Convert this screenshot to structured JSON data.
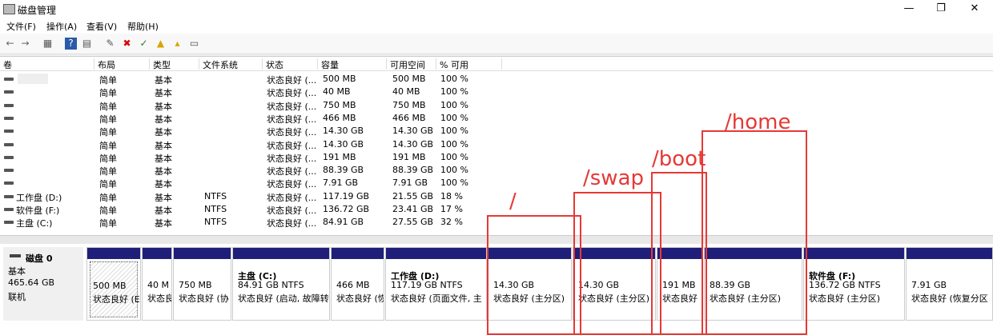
{
  "window": {
    "title": "磁盘管理",
    "minimize": "—",
    "maximize": "❐",
    "close": "✕"
  },
  "menu": [
    "文件(F)",
    "操作(A)",
    "查看(V)",
    "帮助(H)"
  ],
  "toolbar": [
    "←",
    "→",
    "▦",
    "?",
    "▤",
    "✎",
    "✖",
    "✓",
    "▲",
    "▴",
    "▭"
  ],
  "columns": [
    "卷",
    "布局",
    "类型",
    "文件系统",
    "状态",
    "容量",
    "可用空间",
    "% 可用"
  ],
  "volumes": [
    {
      "name": "",
      "layout": "简单",
      "type": "基本",
      "fs": "",
      "status": "状态良好 (...",
      "capacity": "500 MB",
      "free": "500 MB",
      "pct": "100 %"
    },
    {
      "name": "",
      "layout": "简单",
      "type": "基本",
      "fs": "",
      "status": "状态良好 (...",
      "capacity": "40 MB",
      "free": "40 MB",
      "pct": "100 %"
    },
    {
      "name": "",
      "layout": "简单",
      "type": "基本",
      "fs": "",
      "status": "状态良好 (...",
      "capacity": "750 MB",
      "free": "750 MB",
      "pct": "100 %"
    },
    {
      "name": "",
      "layout": "简单",
      "type": "基本",
      "fs": "",
      "status": "状态良好 (...",
      "capacity": "466 MB",
      "free": "466 MB",
      "pct": "100 %"
    },
    {
      "name": "",
      "layout": "简单",
      "type": "基本",
      "fs": "",
      "status": "状态良好 (...",
      "capacity": "14.30 GB",
      "free": "14.30 GB",
      "pct": "100 %"
    },
    {
      "name": "",
      "layout": "简单",
      "type": "基本",
      "fs": "",
      "status": "状态良好 (...",
      "capacity": "14.30 GB",
      "free": "14.30 GB",
      "pct": "100 %"
    },
    {
      "name": "",
      "layout": "简单",
      "type": "基本",
      "fs": "",
      "status": "状态良好 (...",
      "capacity": "191 MB",
      "free": "191 MB",
      "pct": "100 %"
    },
    {
      "name": "",
      "layout": "简单",
      "type": "基本",
      "fs": "",
      "status": "状态良好 (...",
      "capacity": "88.39 GB",
      "free": "88.39 GB",
      "pct": "100 %"
    },
    {
      "name": "",
      "layout": "简单",
      "type": "基本",
      "fs": "",
      "status": "状态良好 (...",
      "capacity": "7.91 GB",
      "free": "7.91 GB",
      "pct": "100 %"
    },
    {
      "name": "工作盘 (D:)",
      "layout": "简单",
      "type": "基本",
      "fs": "NTFS",
      "status": "状态良好 (...",
      "capacity": "117.19 GB",
      "free": "21.55 GB",
      "pct": "18 %"
    },
    {
      "name": "软件盘 (F:)",
      "layout": "简单",
      "type": "基本",
      "fs": "NTFS",
      "status": "状态良好 (...",
      "capacity": "136.72 GB",
      "free": "23.41 GB",
      "pct": "17 %"
    },
    {
      "name": "主盘 (C:)",
      "layout": "简单",
      "type": "基本",
      "fs": "NTFS",
      "status": "状态良好 (...",
      "capacity": "84.91 GB",
      "free": "27.55 GB",
      "pct": "32 %"
    }
  ],
  "disk": {
    "name": "磁盘 0",
    "type": "基本",
    "size": "465.64 GB",
    "state": "联机"
  },
  "partitions": [
    {
      "name": "",
      "size": "500 MB",
      "status": "状态良好 (E"
    },
    {
      "name": "",
      "size": "40 M",
      "status": "状态良"
    },
    {
      "name": "",
      "size": "750 MB",
      "status": "状态良好 (协"
    },
    {
      "name": "主盘  (C:)",
      "size": "84.91 GB NTFS",
      "status": "状态良好 (启动, 故障转"
    },
    {
      "name": "",
      "size": "466 MB",
      "status": "状态良好 (恢"
    },
    {
      "name": "工作盘  (D:)",
      "size": "117.19 GB NTFS",
      "status": "状态良好 (页面文件, 主"
    },
    {
      "name": "",
      "size": "14.30 GB",
      "status": "状态良好 (主分区)"
    },
    {
      "name": "",
      "size": "14.30 GB",
      "status": "状态良好 (主分区)"
    },
    {
      "name": "",
      "size": "191 MB",
      "status": "状态良好"
    },
    {
      "name": "",
      "size": "88.39 GB",
      "status": "状态良好 (主分区)"
    },
    {
      "name": "软件盘  (F:)",
      "size": "136.72 GB NTFS",
      "status": "状态良好 (主分区)"
    },
    {
      "name": "",
      "size": "7.91 GB",
      "status": "状态良好 (恢复分区"
    }
  ],
  "annotations": [
    "/",
    "/swap",
    "/boot",
    "/home"
  ],
  "colors": {
    "partition_bar": "#1f1f7a",
    "annotation": "#e53935"
  }
}
